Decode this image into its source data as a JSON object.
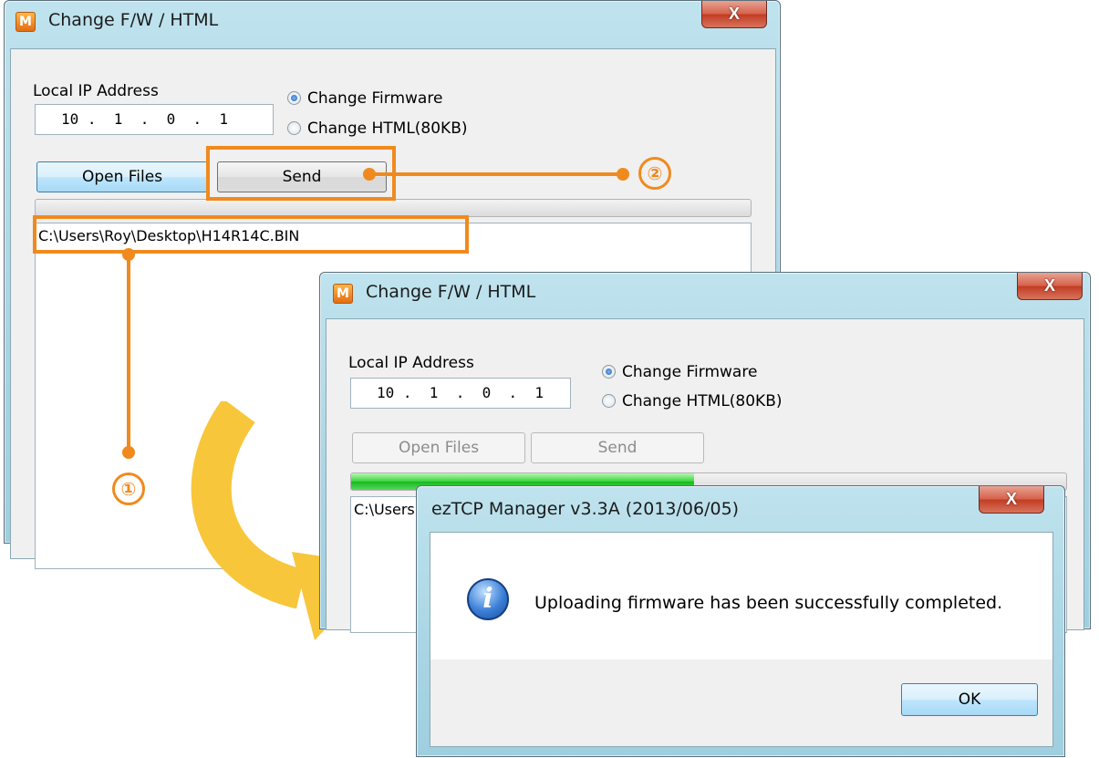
{
  "window1": {
    "title": "Change F/W / HTML",
    "app_icon": "M",
    "close": "X",
    "ip_label": "Local IP Address",
    "ip_value": "10 .  1  .  0  .  1",
    "radio_firmware": "Change Firmware",
    "radio_html": "Change HTML(80KB)",
    "open_files": "Open Files",
    "send": "Send",
    "file_path": "C:\\Users\\Roy\\Desktop\\H14R14C.BIN"
  },
  "window2": {
    "title": "Change F/W / HTML",
    "app_icon": "M",
    "close": "X",
    "ip_label": "Local IP Address",
    "ip_value": "10 .  1  .  0  .  1",
    "radio_firmware": "Change Firmware",
    "radio_html": "Change HTML(80KB)",
    "open_files": "Open Files",
    "send": "Send",
    "progress": 0.48,
    "file_path": "C:\\Users"
  },
  "messagebox": {
    "title": "ezTCP Manager v3.3A (2013/06/05)",
    "close": "X",
    "message": "Uploading firmware has been successfully completed.",
    "icon": "info-icon",
    "icon_glyph": "i",
    "ok": "OK"
  },
  "annotations": {
    "step1": "①",
    "step2": "②",
    "color": "#f08a1e",
    "arrow_color": "#f8c63a"
  }
}
